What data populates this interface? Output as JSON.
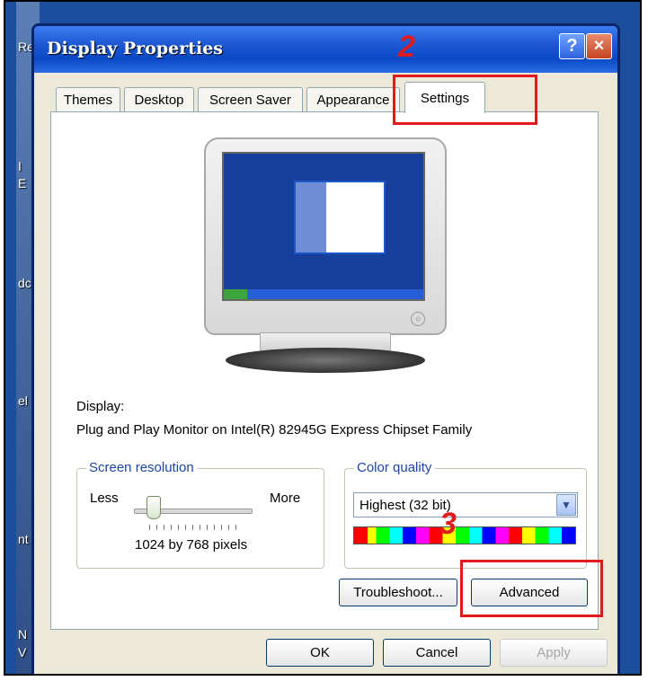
{
  "dialog": {
    "title": "Display Properties",
    "help_label": "?",
    "close_label": "×"
  },
  "tabs": [
    {
      "label": "Themes"
    },
    {
      "label": "Desktop"
    },
    {
      "label": "Screen Saver"
    },
    {
      "label": "Appearance"
    },
    {
      "label": "Settings"
    }
  ],
  "display": {
    "label": "Display:",
    "device": "Plug and Play Monitor on Intel(R) 82945G Express Chipset Family"
  },
  "screen_resolution": {
    "legend": "Screen resolution",
    "less": "Less",
    "more": "More",
    "value": "1024 by 768 pixels",
    "slider_level": 0.1
  },
  "color_quality": {
    "legend": "Color quality",
    "selected": "Highest (32 bit)"
  },
  "buttons": {
    "troubleshoot": "Troubleshoot...",
    "advanced": "Advanced",
    "ok": "OK",
    "cancel": "Cancel",
    "apply": "Apply"
  },
  "annotations": {
    "step2": "2",
    "step3": "3"
  },
  "background_fragments": {
    "desktop_labels": [
      "Re",
      "I",
      "E",
      "dc",
      "el",
      "nt",
      "N",
      "V"
    ]
  },
  "colors": {
    "title_blue": "#0b48c5",
    "highlight_red": "#e01b1b",
    "dialog_bg": "#ece9d8"
  }
}
